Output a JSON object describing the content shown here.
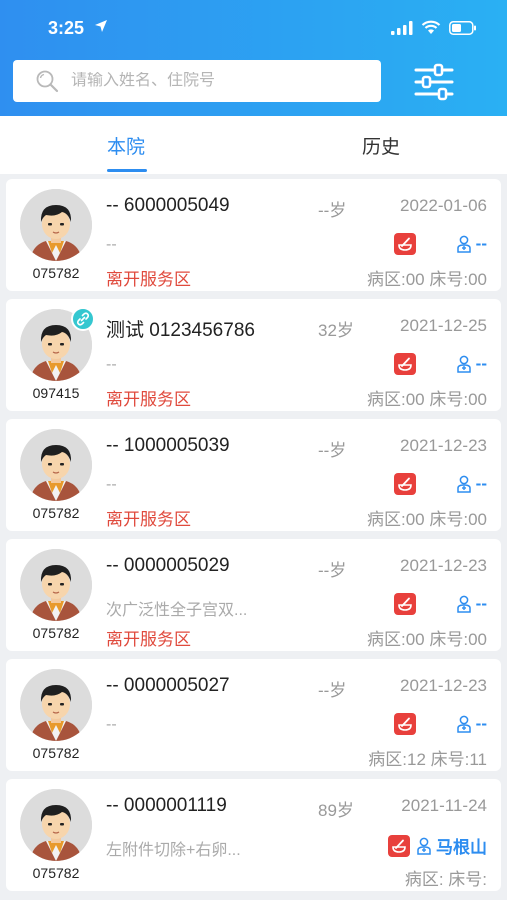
{
  "status_bar": {
    "time": "3:25"
  },
  "search": {
    "placeholder": "请输入姓名、住院号"
  },
  "tabs": [
    {
      "label": "本院",
      "active": true
    },
    {
      "label": "历史",
      "active": false
    }
  ],
  "colors": {
    "accent": "#2d8df0",
    "status_red": "#e04a3d",
    "red_icon": "#e8403c"
  },
  "patients": [
    {
      "id": "075782",
      "name_line": "-- 6000005049",
      "age": "--岁",
      "date": "2022-01-06",
      "diagnosis": "--",
      "status": "离开服务区",
      "doctor": "--",
      "ward": "病区:00 床号:00",
      "badge": false
    },
    {
      "id": "097415",
      "name_line": "测试 0123456786",
      "age": "32岁",
      "date": "2021-12-25",
      "diagnosis": "--",
      "status": "离开服务区",
      "doctor": "--",
      "ward": "病区:00 床号:00",
      "badge": true
    },
    {
      "id": "075782",
      "name_line": "-- 1000005039",
      "age": "--岁",
      "date": "2021-12-23",
      "diagnosis": "--",
      "status": "离开服务区",
      "doctor": "--",
      "ward": "病区:00 床号:00",
      "badge": false
    },
    {
      "id": "075782",
      "name_line": "-- 0000005029",
      "age": "--岁",
      "date": "2021-12-23",
      "diagnosis": "次广泛性全子宫双...",
      "status": "离开服务区",
      "doctor": "--",
      "ward": "病区:00 床号:00",
      "badge": false
    },
    {
      "id": "075782",
      "name_line": "-- 0000005027",
      "age": "--岁",
      "date": "2021-12-23",
      "diagnosis": "--",
      "status": "",
      "doctor": "--",
      "ward": "病区:12 床号:11",
      "badge": false
    },
    {
      "id": "075782",
      "name_line": "-- 0000001119",
      "age": "89岁",
      "date": "2021-11-24",
      "diagnosis": "左附件切除+右卵...",
      "status": "",
      "doctor": "马根山",
      "ward": "病区: 床号:",
      "badge": false
    }
  ]
}
